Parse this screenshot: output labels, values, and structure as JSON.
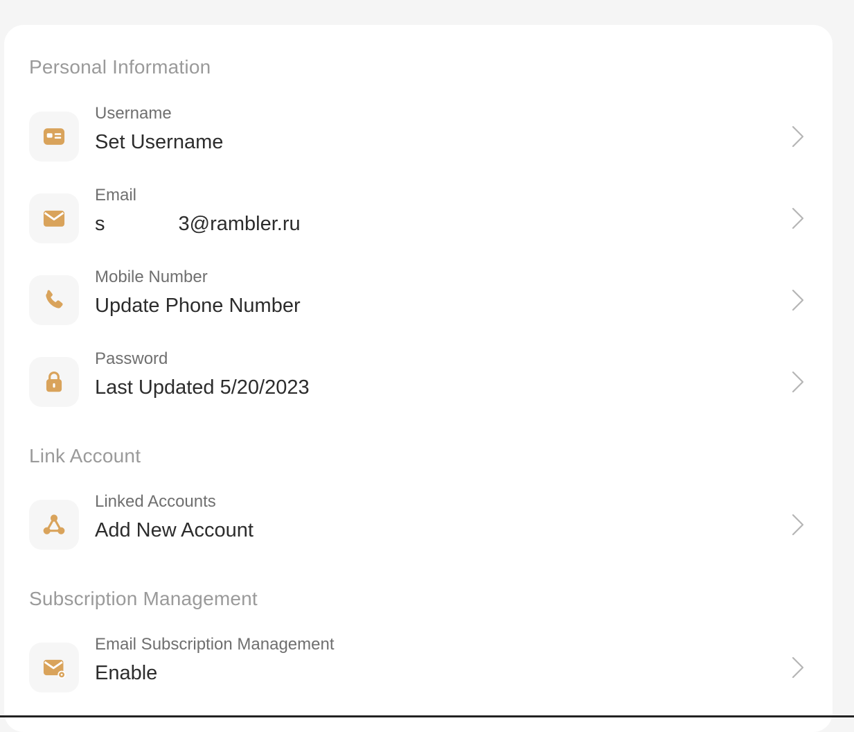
{
  "colors": {
    "accent": "#d9a35b",
    "background": "#f5f5f5",
    "card": "#ffffff"
  },
  "sections": {
    "personal": {
      "title": "Personal Information",
      "items": [
        {
          "icon": "id-card-icon",
          "label": "Username",
          "value": "Set Username"
        },
        {
          "icon": "envelope-icon",
          "label": "Email",
          "value_prefix": "s",
          "value_suffix": "3@rambler.ru"
        },
        {
          "icon": "phone-icon",
          "label": "Mobile Number",
          "value": "Update Phone Number"
        },
        {
          "icon": "lock-icon",
          "label": "Password",
          "value": "Last Updated 5/20/2023"
        }
      ]
    },
    "link": {
      "title": "Link Account",
      "items": [
        {
          "icon": "linked-nodes-icon",
          "label": "Linked Accounts",
          "value": "Add New Account"
        }
      ]
    },
    "subscription": {
      "title": "Subscription Management",
      "items": [
        {
          "icon": "mail-settings-icon",
          "label": "Email Subscription Management",
          "value": "Enable"
        }
      ]
    }
  }
}
